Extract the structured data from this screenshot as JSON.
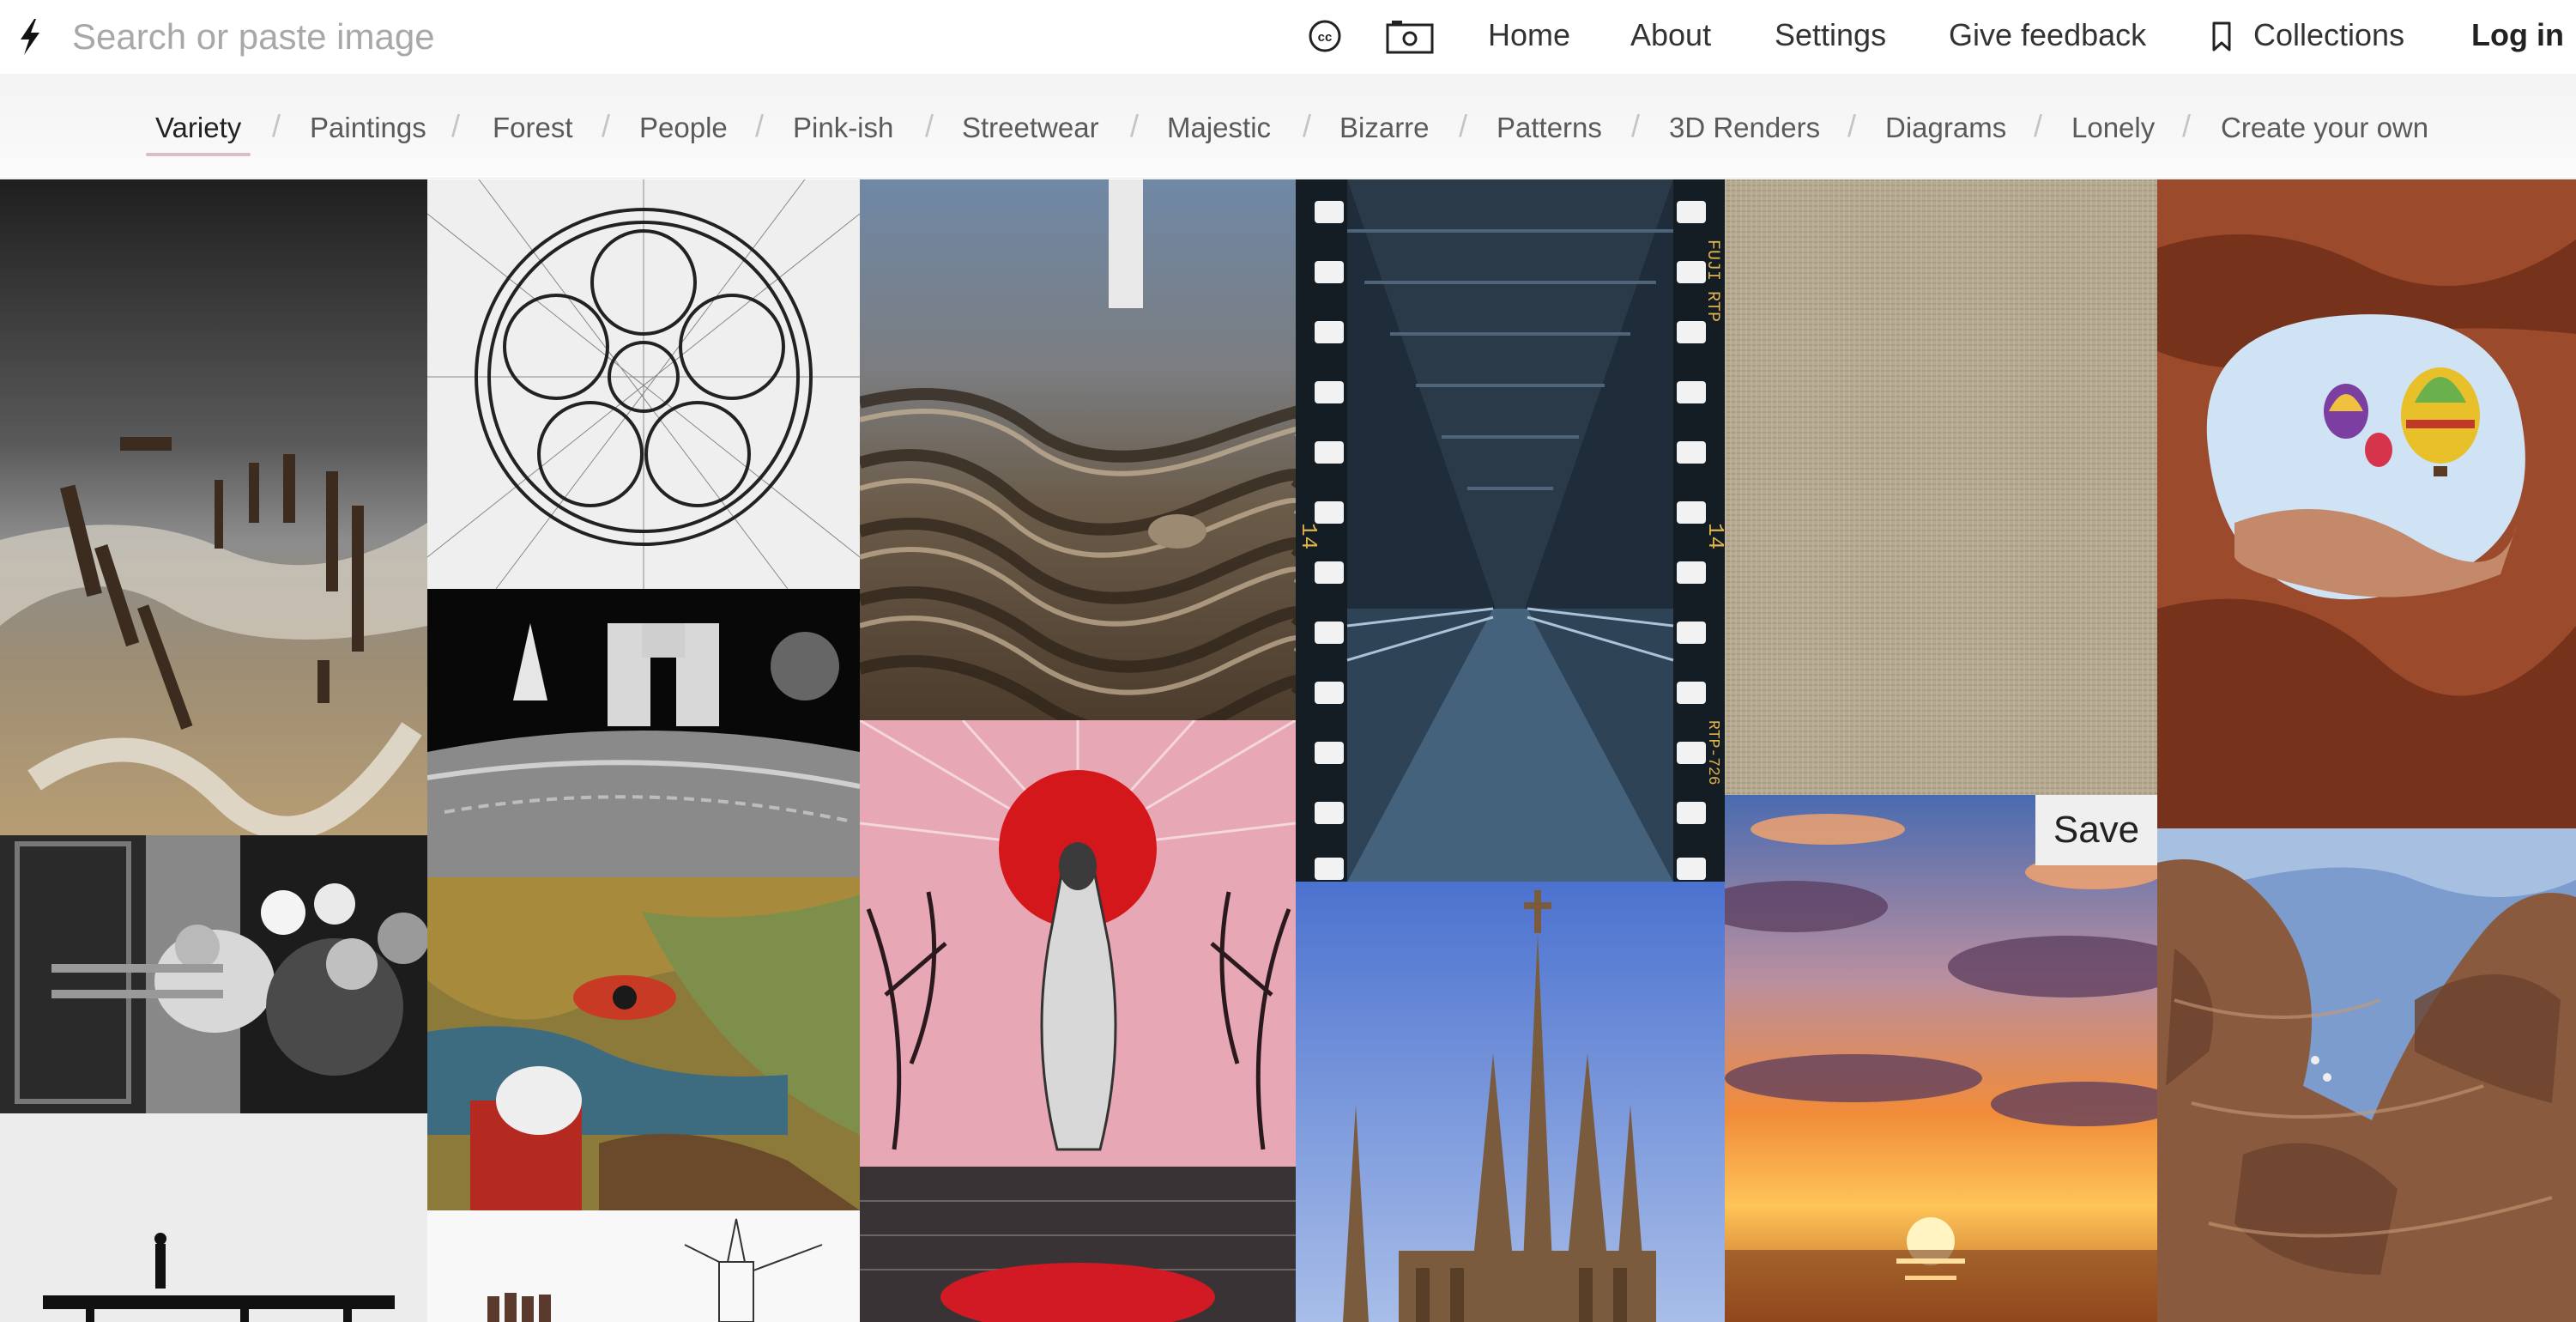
{
  "search": {
    "placeholder": "Search or paste image"
  },
  "nav": {
    "home": "Home",
    "about": "About",
    "settings": "Settings",
    "feedback": "Give feedback",
    "collections": "Collections",
    "login": "Log in"
  },
  "categories": [
    "Variety",
    "Paintings",
    "Forest",
    "People",
    "Pink-ish",
    "Streetwear",
    "Majestic",
    "Bizarre",
    "Patterns",
    "3D Renders",
    "Diagrams",
    "Lonely",
    "Create your own"
  ],
  "active_category": "Variety",
  "separator": "/",
  "save_label": "Save",
  "film_text": {
    "fuji": "FUJI RTP",
    "num": "14",
    "code": "RTP-726"
  },
  "colors": {
    "accent_underline": "#d9bdc9",
    "topbar_bg": "#ffffff",
    "catbar_bg": "#f6f6f6"
  }
}
